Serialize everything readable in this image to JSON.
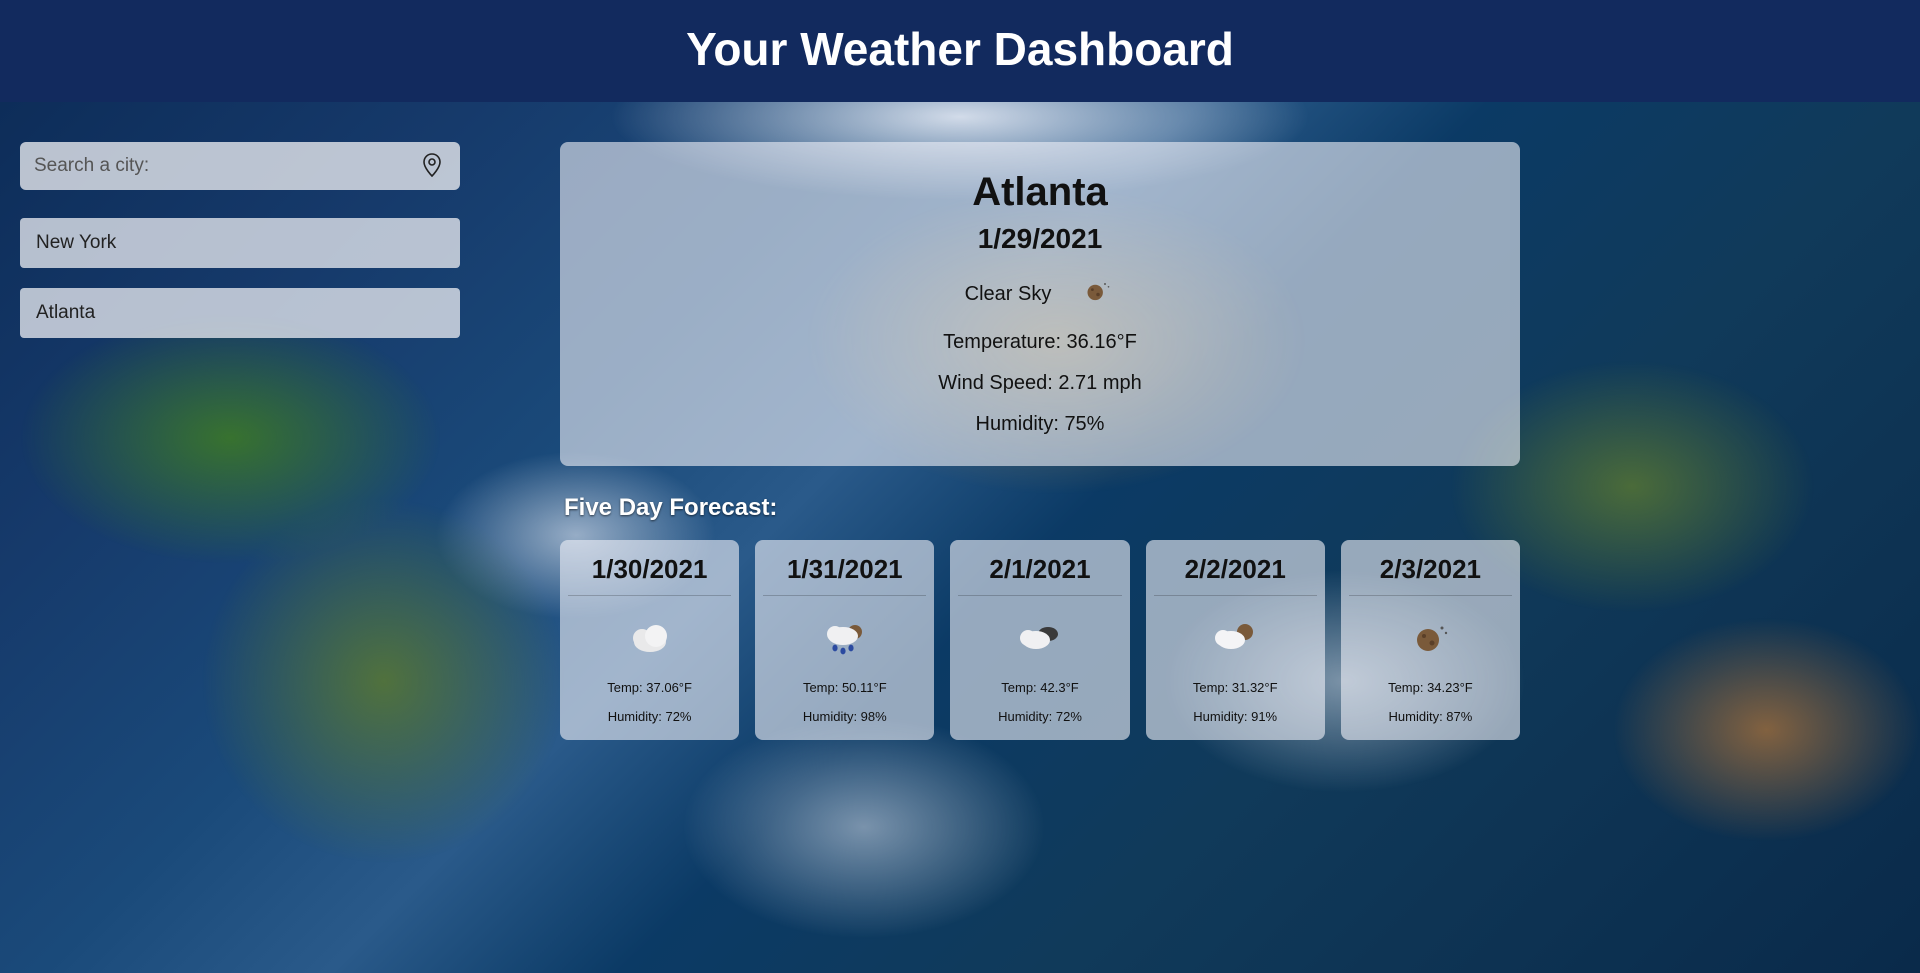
{
  "header": {
    "title": "Your Weather Dashboard"
  },
  "search": {
    "placeholder": "Search a city:"
  },
  "history": [
    {
      "label": "New York"
    },
    {
      "label": "Atlanta"
    }
  ],
  "current": {
    "city": "Atlanta",
    "date": "1/29/2021",
    "condition": "Clear Sky",
    "icon": "clear-night",
    "temperature_label": "Temperature: 36.16°F",
    "wind_label": "Wind Speed: 2.71 mph",
    "humidity_label": "Humidity: 75%"
  },
  "forecast_title": "Five Day Forecast:",
  "forecast": [
    {
      "date": "1/30/2021",
      "icon": "cloud",
      "temp": "Temp: 37.06°F",
      "humidity": "Humidity: 72%"
    },
    {
      "date": "1/31/2021",
      "icon": "rain",
      "temp": "Temp: 50.11°F",
      "humidity": "Humidity: 98%"
    },
    {
      "date": "2/1/2021",
      "icon": "cloudy-dark",
      "temp": "Temp: 42.3°F",
      "humidity": "Humidity: 72%"
    },
    {
      "date": "2/2/2021",
      "icon": "partly-cloudy",
      "temp": "Temp: 31.32°F",
      "humidity": "Humidity: 91%"
    },
    {
      "date": "2/3/2021",
      "icon": "clear-night",
      "temp": "Temp: 34.23°F",
      "humidity": "Humidity: 87%"
    }
  ]
}
